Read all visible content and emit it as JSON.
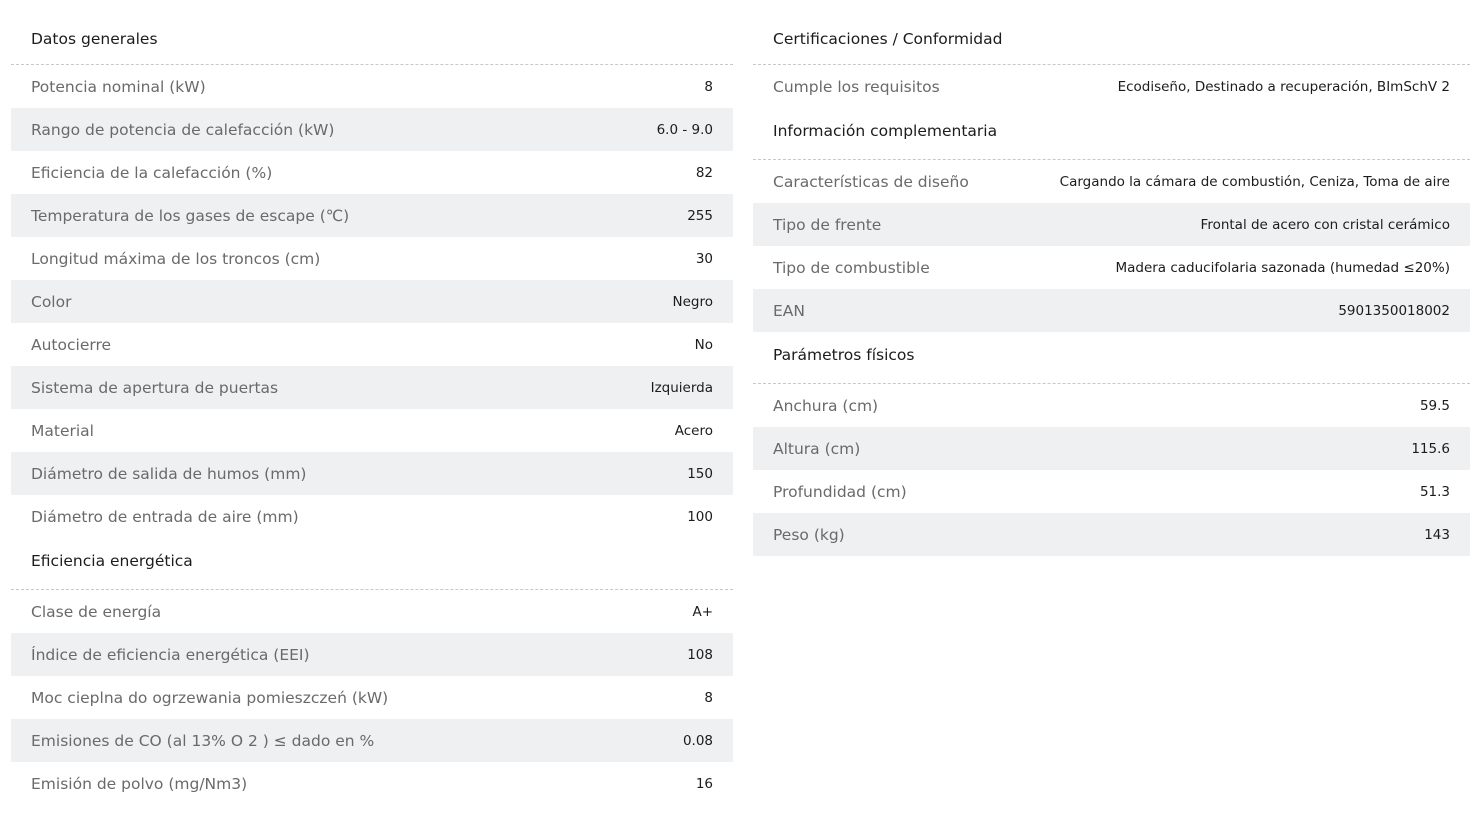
{
  "left": {
    "datos_generales": {
      "title": "Datos generales",
      "rows": [
        {
          "label": "Potencia nominal (kW)",
          "value": "8"
        },
        {
          "label": "Rango de potencia de calefacción (kW)",
          "value": "6.0 - 9.0"
        },
        {
          "label": "Eficiencia de la calefacción (%)",
          "value": "82"
        },
        {
          "label": "Temperatura de los gases de escape (℃)",
          "value": "255"
        },
        {
          "label": "Longitud máxima de los troncos (cm)",
          "value": "30"
        },
        {
          "label": "Color",
          "value": "Negro"
        },
        {
          "label": "Autocierre",
          "value": "No"
        },
        {
          "label": "Sistema de apertura de puertas",
          "value": "Izquierda"
        },
        {
          "label": "Material",
          "value": "Acero"
        },
        {
          "label": "Diámetro de salida de humos (mm)",
          "value": "150"
        },
        {
          "label": "Diámetro de entrada de aire (mm)",
          "value": "100"
        }
      ]
    },
    "eficiencia": {
      "title": "Eficiencia energética",
      "rows": [
        {
          "label": "Clase de energía",
          "value": "A+"
        },
        {
          "label": "Índice de eficiencia energética (EEI)",
          "value": "108"
        },
        {
          "label": "Moc cieplna do ogrzewania pomieszczeń (kW)",
          "value": "8"
        },
        {
          "label": "Emisiones de CO (al 13% O 2 ) ≤ dado en %",
          "value": "0.08"
        },
        {
          "label": "Emisión de polvo (mg/Nm3)",
          "value": "16"
        }
      ]
    }
  },
  "right": {
    "certificaciones": {
      "title": "Certificaciones / Conformidad",
      "rows": [
        {
          "label": "Cumple los requisitos",
          "value": "Ecodiseño, Destinado a recuperación, BImSchV 2"
        }
      ]
    },
    "complementaria": {
      "title": "Información complementaria",
      "rows": [
        {
          "label": "Características de diseño",
          "value": "Cargando la cámara de combustión, Ceniza, Toma de aire"
        },
        {
          "label": "Tipo de frente",
          "value": "Frontal de acero con cristal cerámico"
        },
        {
          "label": "Tipo de combustible",
          "value": "Madera caducifolaria sazonada (humedad ≤20%)"
        },
        {
          "label": "EAN",
          "value": "5901350018002"
        }
      ]
    },
    "fisicos": {
      "title": "Parámetros físicos",
      "rows": [
        {
          "label": "Anchura (cm)",
          "value": "59.5"
        },
        {
          "label": "Altura (cm)",
          "value": "115.6"
        },
        {
          "label": "Profundidad (cm)",
          "value": "51.3"
        },
        {
          "label": "Peso (kg)",
          "value": "143"
        }
      ]
    }
  }
}
